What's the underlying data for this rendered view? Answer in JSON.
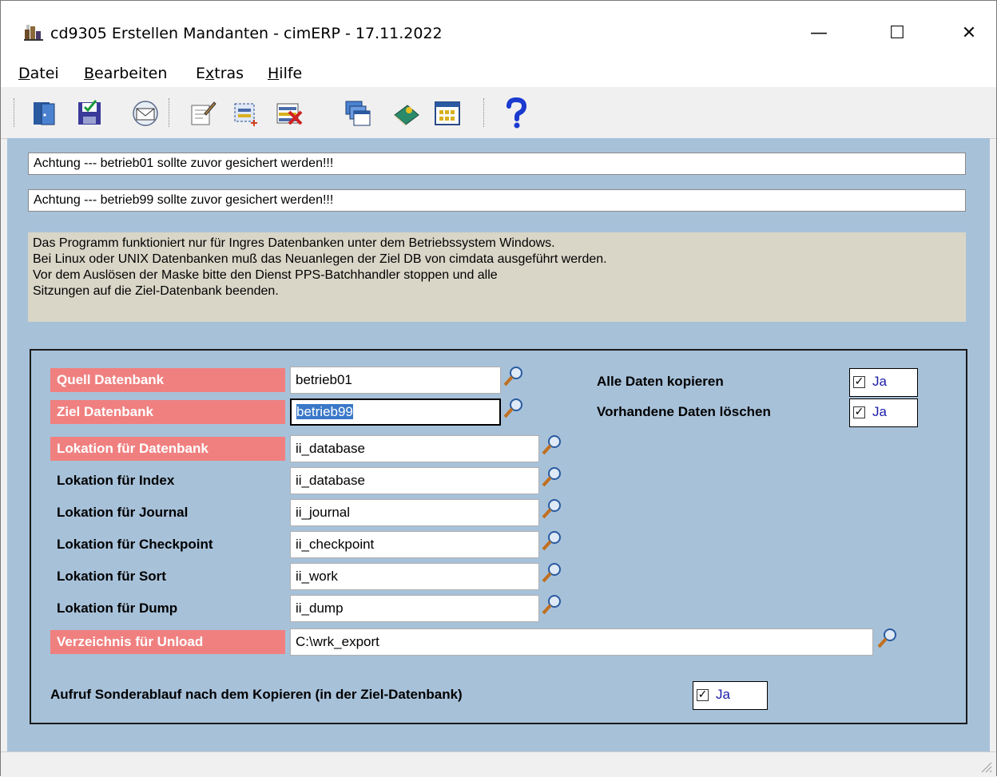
{
  "window": {
    "title": "cd9305 Erstellen Mandanten - cimERP - 17.11.2022",
    "minimize_glyph": "—",
    "maximize_glyph": "☐",
    "close_glyph": "✕"
  },
  "menu": {
    "datei": "Datei",
    "bearbeiten": "Bearbeiten",
    "extras": "Extras",
    "hilfe": "Hilfe"
  },
  "toolbar": {
    "icons": [
      "exit-icon",
      "save-icon",
      "mail-icon",
      "edit-icon",
      "new-record-icon",
      "delete-record-icon",
      "windows-icon",
      "book-icon",
      "calendar-icon",
      "help-icon"
    ]
  },
  "warnings": [
    "Achtung ---  betrieb01 sollte zuvor gesichert werden!!!",
    "Achtung ---  betrieb99 sollte zuvor gesichert werden!!!"
  ],
  "info_lines": [
    "Das Programm funktioniert nur für Ingres Datenbanken unter dem Betriebssystem Windows.",
    "Bei Linux oder UNIX Datenbanken muß das Neuanlegen der Ziel DB von cimdata ausgeführt werden.",
    "Vor dem Auslösen der Maske bitte den Dienst PPS-Batchhandler stoppen und alle",
    "Sitzungen auf die Ziel-Datenbank beenden."
  ],
  "form": {
    "quell": {
      "label": "Quell Datenbank",
      "value": "betrieb01"
    },
    "ziel": {
      "label": "Ziel Datenbank",
      "value": "betrieb99"
    },
    "lok_db": {
      "label": "Lokation für Datenbank",
      "value": "ii_database"
    },
    "lok_index": {
      "label": "Lokation für Index",
      "value": "ii_database"
    },
    "lok_journal": {
      "label": "Lokation für Journal",
      "value": "ii_journal"
    },
    "lok_checkpoint": {
      "label": "Lokation für Checkpoint",
      "value": "ii_checkpoint"
    },
    "lok_sort": {
      "label": "Lokation für Sort",
      "value": "ii_work"
    },
    "lok_dump": {
      "label": "Lokation für Dump",
      "value": "ii_dump"
    },
    "unload": {
      "label": "Verzeichnis für Unload",
      "value": "C:\\wrk_export"
    },
    "alle_daten": {
      "label": "Alle Daten kopieren",
      "checked": true,
      "value": "Ja"
    },
    "vorhandene": {
      "label": "Vorhandene Daten löschen",
      "checked": true,
      "value": "Ja"
    },
    "sonderablauf": {
      "label": "Aufruf Sonderablauf nach dem Kopieren (in der Ziel-Datenbank)",
      "checked": true,
      "value": "Ja"
    }
  },
  "colors": {
    "client_bg": "#a7c1d9",
    "required_label_bg": "#f08080",
    "info_bg": "#d9d6c8",
    "checkbox_text": "#1a1aaa"
  }
}
